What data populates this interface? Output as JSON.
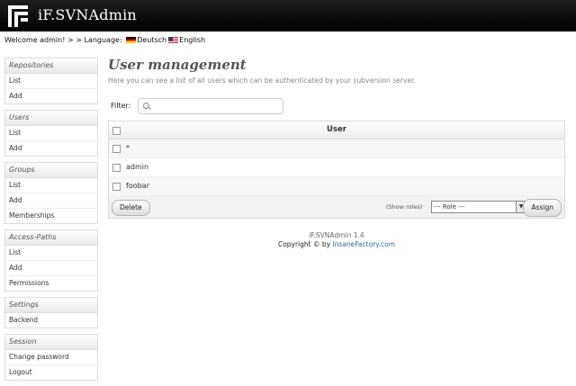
{
  "header": {
    "title": "iF.SVNAdmin"
  },
  "topbar": {
    "welcome": "Welcome admin!",
    "sep": " > > ",
    "language_label": "Language:",
    "lang_de": "Deutsch",
    "lang_en": "English"
  },
  "sidebar": {
    "repositories": {
      "title": "Repositories",
      "items": [
        "List",
        "Add"
      ]
    },
    "users": {
      "title": "Users",
      "items": [
        "List",
        "Add"
      ]
    },
    "groups": {
      "title": "Groups",
      "items": [
        "List",
        "Add",
        "Memberships"
      ]
    },
    "access_paths": {
      "title": "Access-Paths",
      "items": [
        "List",
        "Add",
        "Permissions"
      ]
    },
    "settings": {
      "title": "Settings",
      "items": [
        "Backend"
      ]
    },
    "session": {
      "title": "Session",
      "items": [
        "Change password",
        "Logout"
      ]
    }
  },
  "main": {
    "title": "User management",
    "description": "Here you can see a list of all users which can be authenticated by your subversion server.",
    "filter_label": "Filter:",
    "filter_value": "",
    "table_header": "User",
    "rows": [
      "*",
      "admin",
      "foobar"
    ],
    "delete_label": "Delete",
    "show_roles_label": "(Show roles)",
    "role_value": "--- Role ---",
    "assign_label": "Assign"
  },
  "footer": {
    "version": "iF.SVNAdmin 1.4",
    "copyright_prefix": "Copyright © by ",
    "copyright_link": "InsaneFactory.com"
  }
}
